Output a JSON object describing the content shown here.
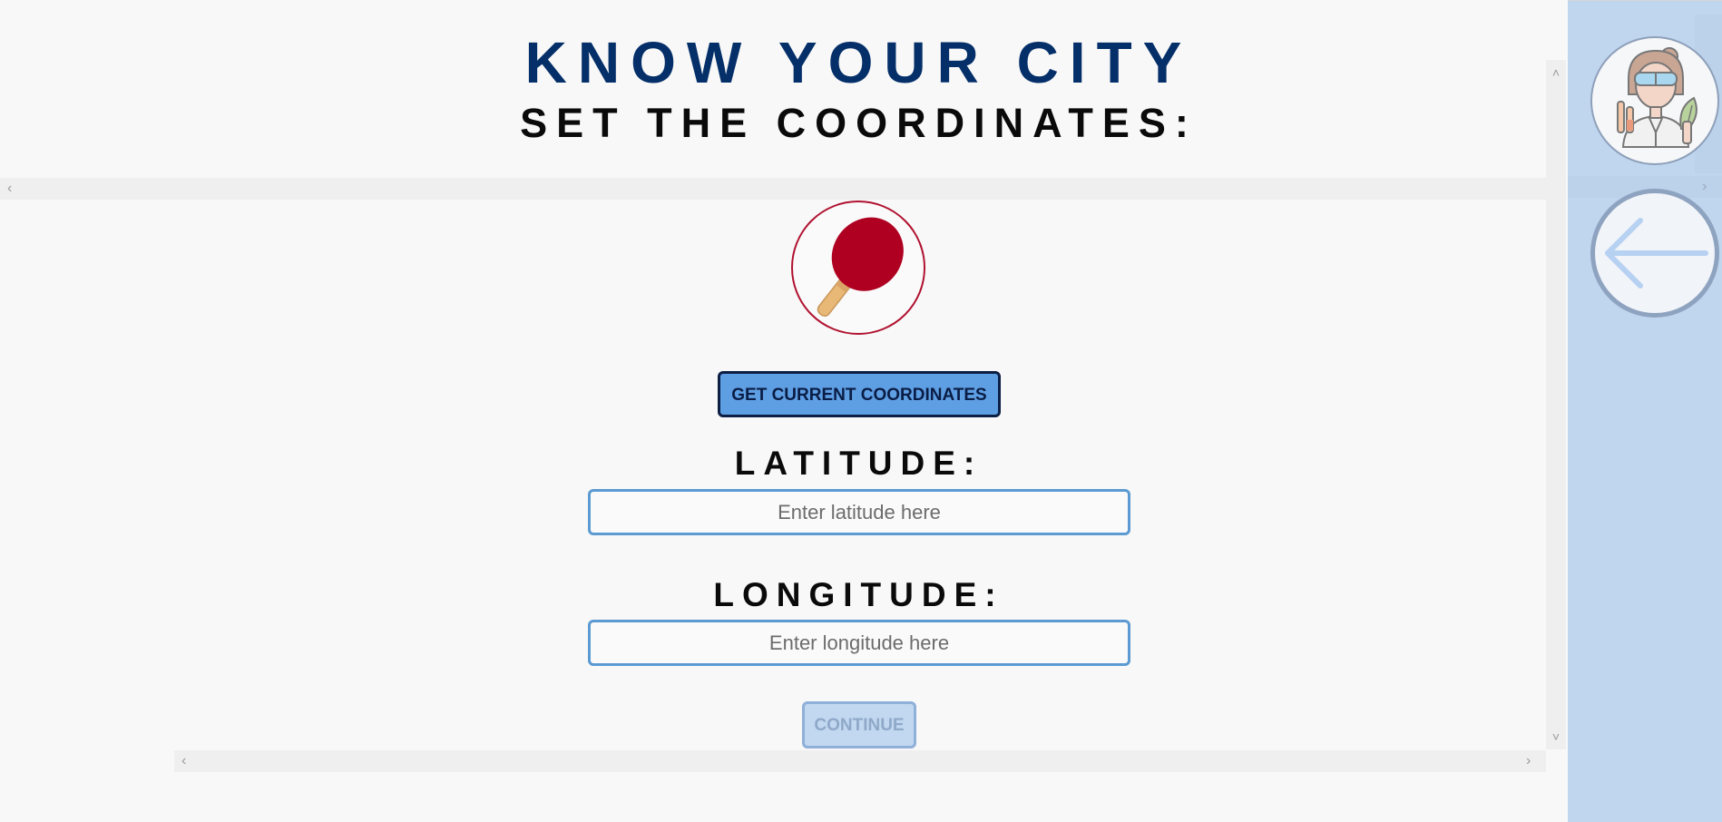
{
  "header": {
    "title": "KNOW YOUR CITY",
    "subtitle": "SET THE COORDINATES:"
  },
  "actions": {
    "get_coords_label": "GET CURRENT COORDINATES",
    "continue_label": "CONTINUE"
  },
  "form": {
    "latitude_label": "LATITUDE:",
    "latitude_placeholder": "Enter latitude here",
    "latitude_value": "",
    "longitude_label": "LONGITUDE:",
    "longitude_placeholder": "Enter longitude here",
    "longitude_value": ""
  },
  "icons": {
    "category": "ping-pong-paddle-icon",
    "avatar": "scientist-avatar-icon",
    "back": "back-arrow-icon",
    "scroll_left": "‹",
    "scroll_right": "›",
    "scroll_up": "˄",
    "scroll_down": "˅"
  },
  "colors": {
    "title": "#042f69",
    "primary_button": "#5e9ee3",
    "field_border": "#5c9ad2",
    "paddle": "#b01230",
    "side_panel": "#c0d6ef"
  }
}
